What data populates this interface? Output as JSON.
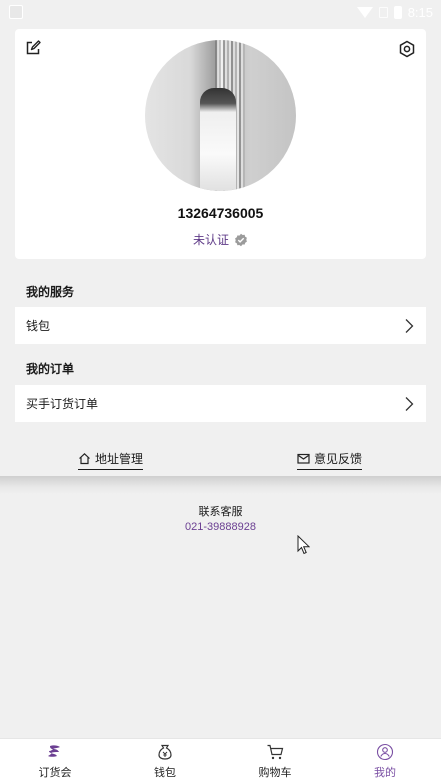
{
  "status_bar": {
    "time": "8:15"
  },
  "profile": {
    "phone": "13264736005",
    "verify_status": "未认证"
  },
  "services": {
    "title": "我的服务",
    "items": [
      {
        "label": "钱包"
      }
    ]
  },
  "orders": {
    "title": "我的订单",
    "items": [
      {
        "label": "买手订货订单"
      }
    ]
  },
  "links": {
    "address": "地址管理",
    "feedback": "意见反馈"
  },
  "customer_service": {
    "label": "联系客服",
    "phone": "021-39888928"
  },
  "tabbar": {
    "tabs": [
      {
        "label": "订货会",
        "icon": "dragon-logo-icon"
      },
      {
        "label": "钱包",
        "icon": "wallet-icon"
      },
      {
        "label": "购物车",
        "icon": "cart-icon"
      },
      {
        "label": "我的",
        "icon": "user-icon",
        "active": true
      }
    ]
  },
  "colors": {
    "accent": "#6b3f92",
    "background": "#f0f0f0"
  }
}
